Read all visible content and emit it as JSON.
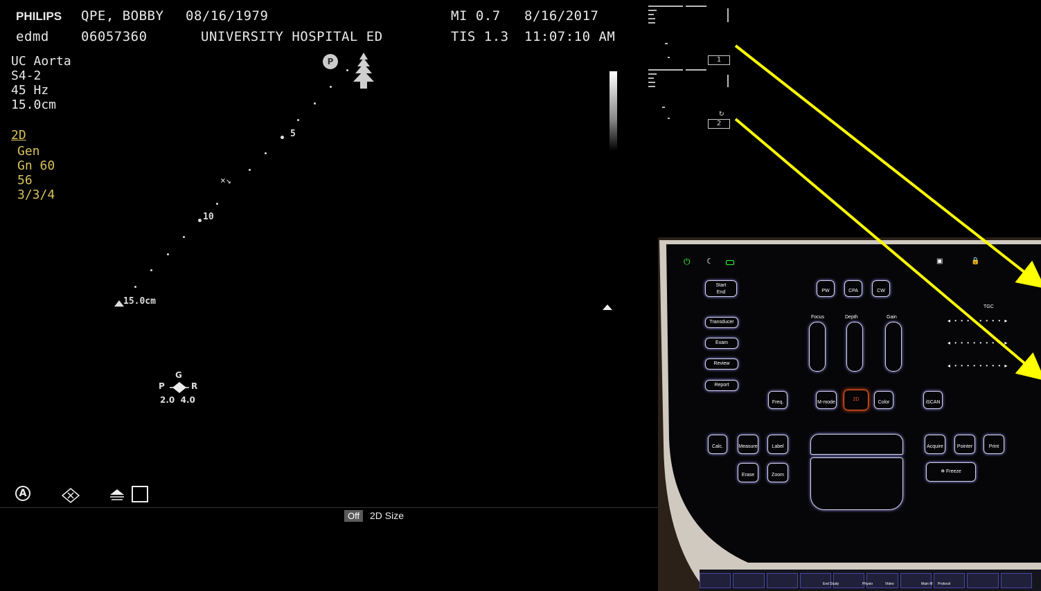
{
  "header": {
    "brand": "PHILIPS",
    "patient_name": "QPE, BOBBY",
    "dob": "08/16/1979",
    "user": "edmd",
    "patient_id": "06057360",
    "institution": "UNIVERSITY HOSPITAL ED",
    "mi": "MI 0.7",
    "tis": "TIS 1.3",
    "date": "8/16/2017",
    "time": "11:07:10 AM"
  },
  "left_info": {
    "preset": "UC Aorta",
    "transducer": "S4-2",
    "frame_rate": "45 Hz",
    "depth": "15.0cm"
  },
  "mode_info": {
    "mode": "2D",
    "setting": "Gen",
    "gain": "Gn 60",
    "value": "56",
    "ratio": "3/3/4"
  },
  "depth_scale": {
    "tick_5": "5",
    "tick_10": "10",
    "bottom": "15.0cm"
  },
  "focus_marker": {
    "p_label": "P",
    "g_label": "G",
    "p2": "P",
    "r_label": "R",
    "values": "2.0  4.0"
  },
  "probe_badge": "P",
  "thumbnails": [
    {
      "label": "1"
    },
    {
      "label": "2"
    }
  ],
  "bottom_bar": {
    "toggle": "Off",
    "label": "2D Size"
  },
  "icons": {
    "auto": "auto-icon",
    "clear": "clear-icon",
    "layer": "layer-icon",
    "square": "square-icon"
  },
  "console": {
    "start_end": "Start\nEnd",
    "pw": "PW",
    "cpa": "CPA",
    "cw": "CW",
    "tgc": "TGC",
    "transducer": "Transducer",
    "exam": "Exam",
    "review": "Review",
    "report": "Report",
    "focus": "Focus",
    "depth": "Depth",
    "gain": "Gain",
    "freq": "Freq.",
    "mmode": "M-mode",
    "twod": "2D",
    "color": "Color",
    "iscan": "iSCAN",
    "calc": "Calc.",
    "measure": "Measure",
    "label": "Label",
    "acquire": "Acquire",
    "pointer": "Pointer",
    "print": "Print",
    "erase": "Erase",
    "zoom": "Zoom",
    "freeze": "Freeze",
    "bottom_keys": [
      "End Study",
      "Physio",
      "Video",
      "Main M",
      "Protocol"
    ]
  },
  "colors": {
    "background": "#000000",
    "text": "#e9e9e9",
    "yellow_text": "#d8c25a",
    "arrow": "#ffff00",
    "console_glow": "#9a95ff",
    "twod_button": "#ff5a1f",
    "power_green": "#33ff33"
  }
}
